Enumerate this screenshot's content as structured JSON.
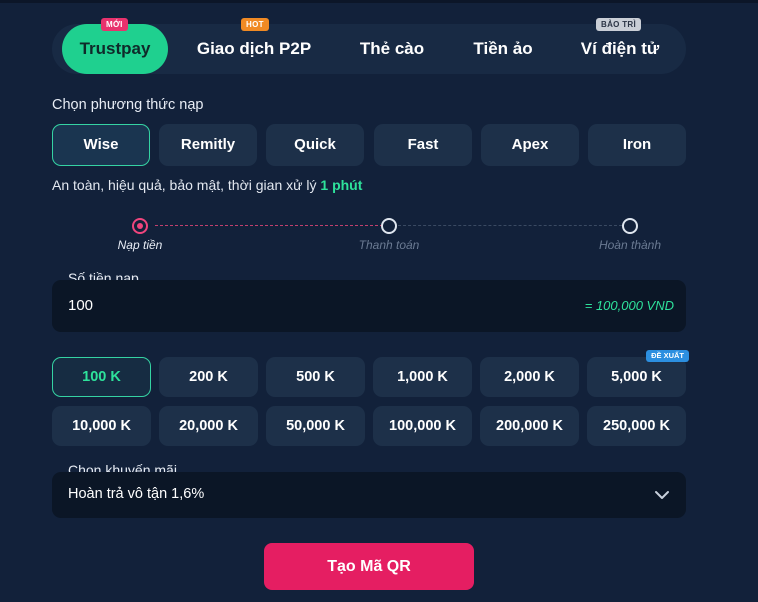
{
  "colors": {
    "accent": "#1fd08f",
    "pink": "#e51e62",
    "step_active": "#f0457d",
    "bg": "#12213a"
  },
  "tabs": [
    {
      "label": "Trustpay",
      "badge": "MỚI",
      "badge_color": "#e8326d"
    },
    {
      "label": "Giao dịch P2P",
      "badge": "HOT",
      "badge_color": "#f08a24"
    },
    {
      "label": "Thẻ cào",
      "badge": ""
    },
    {
      "label": "Tiền ảo",
      "badge": ""
    },
    {
      "label": "Ví điện tử",
      "badge": "BẢO TRÌ",
      "badge_color": "#c9ced6"
    }
  ],
  "method_section": {
    "label": "Chọn phương thức nạp",
    "methods": [
      "Wise",
      "Remitly",
      "Quick",
      "Fast",
      "Apex",
      "Iron"
    ],
    "selected": "Wise",
    "desc_prefix": "An toàn, hiệu quả, bảo mật, thời gian xử lý ",
    "desc_highlight": "1 phút"
  },
  "steps": [
    "Nạp tiền",
    "Thanh toán",
    "Hoàn thành"
  ],
  "amount": {
    "label": "Số tiền nạp",
    "value": "100",
    "converted": "= 100,000 VND"
  },
  "presets": [
    "100 K",
    "200 K",
    "500 K",
    "1,000 K",
    "2,000 K",
    "5,000 K",
    "10,000 K",
    "20,000 K",
    "50,000 K",
    "100,000 K",
    "200,000 K",
    "250,000 K"
  ],
  "preset_selected": "100 K",
  "preset_badge": "ĐỀ XUẤT",
  "promo": {
    "label": "Chọn khuyến mãi",
    "value": "Hoàn trả vô tận 1,6%"
  },
  "submit_label": "Tạo Mã QR"
}
